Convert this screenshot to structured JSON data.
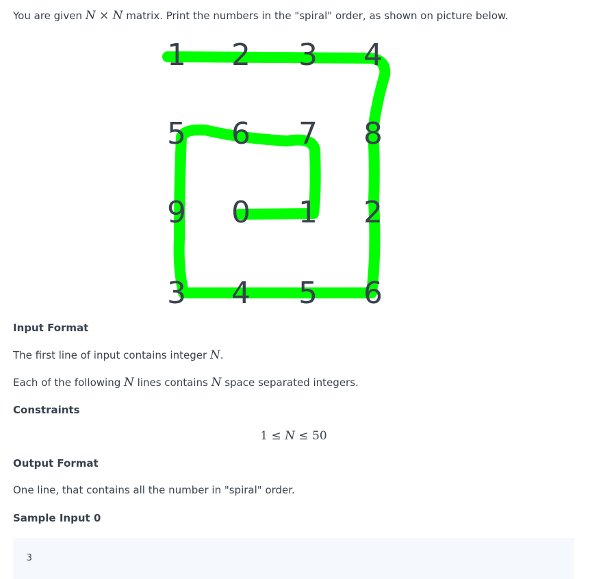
{
  "intro": {
    "text_before": "You are given ",
    "math_n1": "N",
    "times": " × ",
    "math_n2": "N",
    "text_after": " matrix. Print the numbers in the \"spiral\" order, as shown on picture below."
  },
  "figure": {
    "digits": [
      "1",
      "2",
      "3",
      "4",
      "5",
      "6",
      "7",
      "8",
      "9",
      "0",
      "1",
      "2",
      "3",
      "4",
      "5",
      "6"
    ],
    "spiral_color": "#00ff00"
  },
  "input_format": {
    "heading": "Input Format",
    "line1_before": "The first line of input contains integer ",
    "line1_math": "N",
    "line1_after": ".",
    "line2_before": "Each of the following ",
    "line2_math1": "N",
    "line2_middle": " lines contains ",
    "line2_math2": "N",
    "line2_after": " space separated integers."
  },
  "constraints": {
    "heading": "Constraints",
    "lower": "1",
    "le1": " ≤ ",
    "var": "N",
    "le2": " ≤ ",
    "upper": "50"
  },
  "output_format": {
    "heading": "Output Format",
    "text": "One line, that contains all the number in \"spiral\" order."
  },
  "sample_input": {
    "heading": "Sample Input 0",
    "first_line": "3"
  }
}
